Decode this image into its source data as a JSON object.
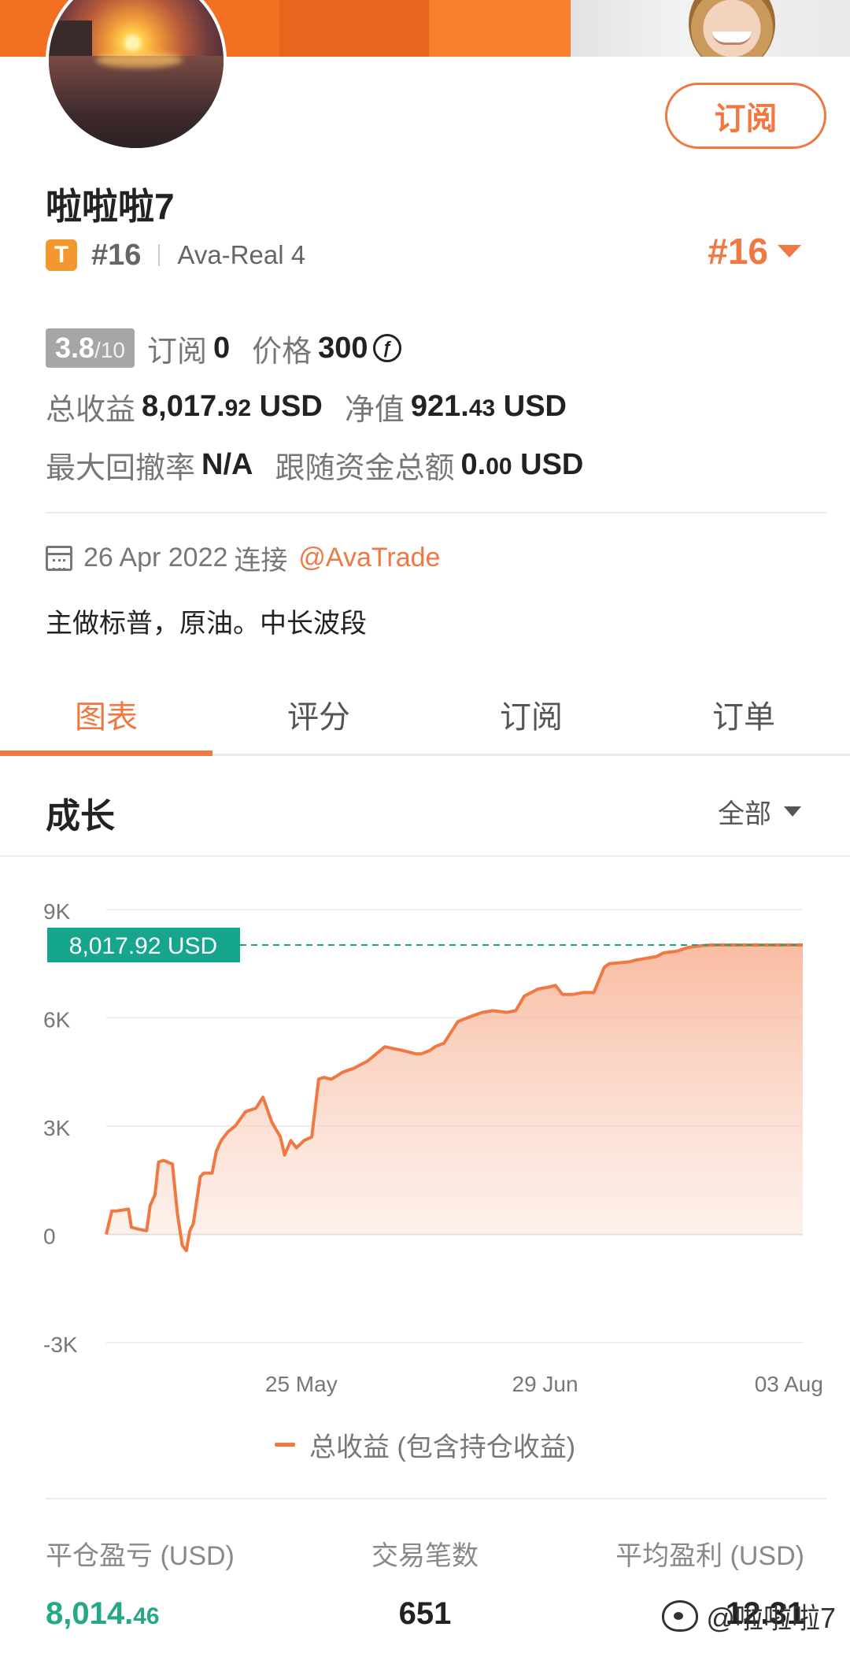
{
  "profile": {
    "username": "啦啦啦7",
    "badge": "T",
    "rank": "#16",
    "rank_right": "#16",
    "account": "Ava-Real 4",
    "subscribe_label": "订阅"
  },
  "stats": {
    "score": "3.8",
    "score_den": "/10",
    "subscribers_label": "订阅",
    "subscribers_value": "0",
    "price_label": "价格",
    "price_value": "300",
    "coin_symbol": "ƒ",
    "total_profit_label": "总收益",
    "total_profit_int": "8,017.",
    "total_profit_dec": "92",
    "total_profit_unit": " USD",
    "equity_label": "净值",
    "equity_int": "921.",
    "equity_dec": "43",
    "equity_unit": " USD",
    "max_drawdown_label": "最大回撤率",
    "max_drawdown_value": "N/A",
    "follow_funds_label": "跟随资金总额",
    "follow_funds_int": "0.",
    "follow_funds_dec": "00",
    "follow_funds_unit": " USD"
  },
  "connection": {
    "date": "26 Apr 2022",
    "connect_word": "连接",
    "broker": "@AvaTrade"
  },
  "description": "主做标普，原油。中长波段",
  "tabs": [
    {
      "label": "图表",
      "active": true
    },
    {
      "label": "评分",
      "active": false
    },
    {
      "label": "订阅",
      "active": false
    },
    {
      "label": "订单",
      "active": false
    }
  ],
  "growth": {
    "title": "成长",
    "filter_label": "全部"
  },
  "chart_data": {
    "type": "area",
    "y_ticks": [
      "9K",
      "6K",
      "3K",
      "0",
      "-3K"
    ],
    "y_tick_values": [
      9000,
      6000,
      3000,
      0,
      -3000
    ],
    "ylim": [
      -3000,
      9000
    ],
    "x_ticks": [
      "25 May",
      "29 Jun",
      "03 Aug"
    ],
    "x_tick_positions": [
      28,
      63,
      98
    ],
    "xlim": [
      0,
      100
    ],
    "current_label": "8,017.92 USD",
    "current_value": 8017.92,
    "series": [
      {
        "name": "总收益 (包含持仓收益)",
        "color": "#ef7843",
        "x": [
          0,
          0.8,
          1.5,
          3.2,
          3.6,
          4.5,
          5.8,
          6.3,
          7.0,
          7.5,
          8.2,
          9.5,
          10.2,
          10.9,
          11.5,
          12.0,
          12.5,
          13.5,
          14.0,
          15.2,
          15.8,
          16.5,
          17.5,
          18.5,
          20.0,
          21.5,
          22.5,
          23.8,
          25.0,
          25.6,
          26.5,
          27.3,
          28.4,
          29.5,
          30.5,
          31.2,
          32.3,
          34.0,
          35.5,
          36.5,
          37.5,
          40.0,
          42.5,
          44.5,
          45.2,
          46.5,
          47.2,
          48.5,
          50.5,
          52.5,
          54.0,
          55.5,
          57.5,
          58.8,
          60.0,
          62.0,
          63.5,
          64.5,
          65.5,
          67.0,
          68.5,
          70.0,
          71.5,
          72.2,
          75.0,
          76.0,
          79.0,
          80.0,
          82.0,
          83.5,
          85.5,
          87.0,
          89.0,
          91.0,
          93.5,
          95.5,
          97.0,
          99.0,
          100.0
        ],
        "y": [
          0,
          650,
          650,
          700,
          200,
          150,
          100,
          800,
          1100,
          2000,
          2050,
          1950,
          600,
          -300,
          -450,
          100,
          300,
          1600,
          1700,
          1700,
          2300,
          2600,
          2850,
          3000,
          3400,
          3500,
          3800,
          3100,
          2700,
          2200,
          2600,
          2400,
          2600,
          2700,
          4300,
          4350,
          4300,
          4500,
          4600,
          4700,
          4800,
          5200,
          5100,
          5000,
          5000,
          5100,
          5200,
          5300,
          5900,
          6050,
          6150,
          6200,
          6150,
          6200,
          6600,
          6800,
          6850,
          6900,
          6650,
          6650,
          6700,
          6700,
          7400,
          7500,
          7550,
          7600,
          7700,
          7800,
          7850,
          7950,
          8000,
          8017.92,
          8017.92,
          8017.92,
          8017.92,
          8017.92,
          8017.92,
          8017.92,
          8017.92
        ]
      }
    ],
    "legend": "总收益 (包含持仓收益)",
    "grid": true
  },
  "bottom": {
    "closed_pl_label": "平仓盈亏 (USD)",
    "closed_pl_int": "8,014.",
    "closed_pl_dec": "46",
    "trades_label": "交易笔数",
    "trades_value": "651",
    "avg_profit_label": "平均盈利 (USD)",
    "avg_profit_value": "12.31"
  },
  "watermark": "@啦啦啦7",
  "colors": {
    "accent": "#ef7843",
    "green": "#24a886",
    "teal_label": "#16a68e"
  }
}
